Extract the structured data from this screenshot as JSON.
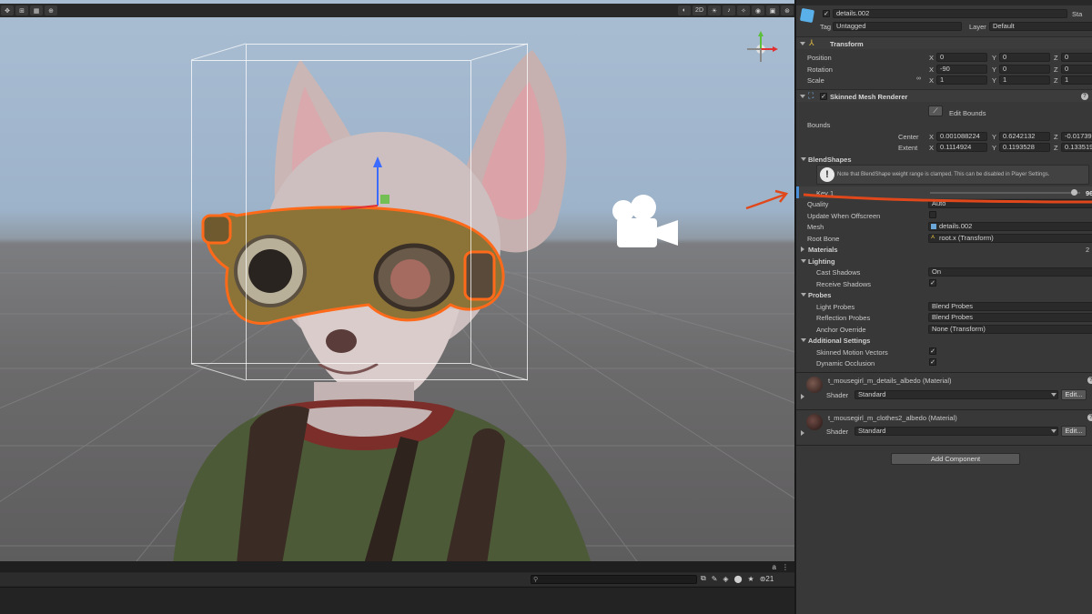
{
  "scene_toolbar": {
    "btn_2d": "2D"
  },
  "inspector": {
    "object_name": "details.002",
    "static_label": "Sta",
    "tag_label": "Tag",
    "tag_value": "Untagged",
    "layer_label": "Layer",
    "layer_value": "Default",
    "transform": {
      "title": "Transform",
      "position_label": "Position",
      "rotation_label": "Rotation",
      "scale_label": "Scale",
      "position": {
        "x": "0",
        "y": "0",
        "z": "0"
      },
      "rotation": {
        "x": "-90",
        "y": "0",
        "z": "0"
      },
      "scale": {
        "x": "1",
        "y": "1",
        "z": "1"
      }
    },
    "skinned_mesh_renderer": {
      "title": "Skinned Mesh Renderer",
      "edit_bounds": "Edit Bounds",
      "bounds_label": "Bounds",
      "center_label": "Center",
      "extent_label": "Extent",
      "center": {
        "x": "0.001088224",
        "y": "0.6242132",
        "z": "-0.01739"
      },
      "extent": {
        "x": "0.1114924",
        "y": "0.1193528",
        "z": "0.133519"
      },
      "blendshapes_title": "BlendShapes",
      "blendshape_note": "Note that BlendShape weight range is clamped. This can be disabled in Player Settings.",
      "key1_label": "Key 1",
      "key1_value": "96",
      "key1_weight": 0.96,
      "quality_label": "Quality",
      "quality_value": "Auto",
      "update_offscreen_label": "Update When Offscreen",
      "mesh_label": "Mesh",
      "mesh_value": "details.002",
      "root_bone_label": "Root Bone",
      "root_bone_value": "root.x (Transform)",
      "materials_label": "Materials",
      "materials_count": "2",
      "lighting_label": "Lighting",
      "cast_shadows_label": "Cast Shadows",
      "cast_shadows_value": "On",
      "receive_shadows_label": "Receive Shadows",
      "probes_label": "Probes",
      "light_probes_label": "Light Probes",
      "light_probes_value": "Blend Probes",
      "reflection_probes_label": "Reflection Probes",
      "reflection_probes_value": "Blend Probes",
      "anchor_override_label": "Anchor Override",
      "anchor_override_value": "None (Transform)",
      "additional_settings_label": "Additional Settings",
      "skinned_motion_vectors_label": "Skinned Motion Vectors",
      "dynamic_occlusion_label": "Dynamic Occlusion"
    },
    "materials": [
      {
        "name": "t_mousegirl_m_details_albedo (Material)",
        "shader_label": "Shader",
        "shader_value": "Standard",
        "edit_label": "Edit..."
      },
      {
        "name": "t_mousegirl_m_clothes2_albedo (Material)",
        "shader_label": "Shader",
        "shader_value": "Standard",
        "edit_label": "Edit..."
      }
    ],
    "add_component": "Add Component"
  },
  "console": {
    "count_badge": "21"
  },
  "colors": {
    "selection_outline": "#ff6a1a",
    "annotation_arrow": "#e0481c",
    "inspector_bg": "#383838"
  }
}
